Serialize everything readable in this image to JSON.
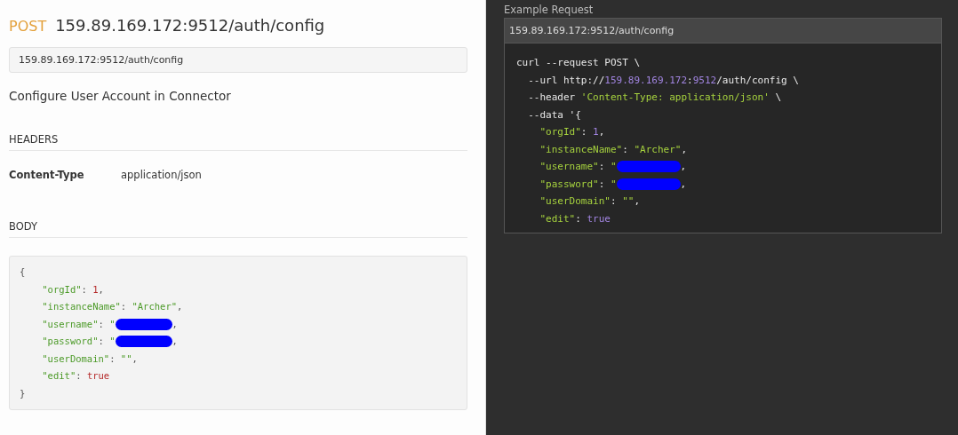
{
  "endpoint": {
    "method": "POST",
    "path": "159.89.169.172:9512/auth/config",
    "url_field": "159.89.169.172:9512/auth/config",
    "description": "Configure User Account in Connector"
  },
  "headers": {
    "title": "HEADERS",
    "rows": [
      {
        "name": "Content-Type",
        "value": "application/json"
      }
    ]
  },
  "body": {
    "title": "BODY",
    "lines": [
      [
        {
          "kind": "punct",
          "text": "{"
        }
      ],
      [
        {
          "kind": "key",
          "text": "    \"orgId\""
        },
        {
          "kind": "punct",
          "text": ": "
        },
        {
          "kind": "number",
          "text": "1"
        },
        {
          "kind": "punct",
          "text": ","
        }
      ],
      [
        {
          "kind": "key",
          "text": "    \"instanceName\""
        },
        {
          "kind": "punct",
          "text": ": "
        },
        {
          "kind": "string",
          "text": "\"Archer\""
        },
        {
          "kind": "punct",
          "text": ","
        }
      ],
      [
        {
          "kind": "key",
          "text": "    \"username\""
        },
        {
          "kind": "punct",
          "text": ": "
        },
        {
          "kind": "string",
          "text": "\""
        },
        {
          "kind": "redaction"
        },
        {
          "kind": "punct",
          "text": ","
        }
      ],
      [
        {
          "kind": "key",
          "text": "    \"password\""
        },
        {
          "kind": "punct",
          "text": ": "
        },
        {
          "kind": "string",
          "text": "\""
        },
        {
          "kind": "redaction"
        },
        {
          "kind": "punct",
          "text": ","
        }
      ],
      [
        {
          "kind": "key",
          "text": "    \"userDomain\""
        },
        {
          "kind": "punct",
          "text": ": "
        },
        {
          "kind": "string",
          "text": "\"\""
        },
        {
          "kind": "punct",
          "text": ","
        }
      ],
      [
        {
          "kind": "key",
          "text": "    \"edit\""
        },
        {
          "kind": "punct",
          "text": ": "
        },
        {
          "kind": "number",
          "text": "true"
        }
      ],
      [
        {
          "kind": "punct",
          "text": "}"
        }
      ]
    ]
  },
  "example": {
    "title": "Example Request",
    "url": "159.89.169.172:9512/auth/config",
    "lines": [
      [
        {
          "kind": "plain",
          "text": "curl --request POST \\"
        }
      ],
      [
        {
          "kind": "plain",
          "text": "  --url http://"
        },
        {
          "kind": "number",
          "text": "159.89.169.172"
        },
        {
          "kind": "plain",
          "text": ":"
        },
        {
          "kind": "number",
          "text": "9512"
        },
        {
          "kind": "plain",
          "text": "/auth/config \\"
        }
      ],
      [
        {
          "kind": "plain",
          "text": "  --header "
        },
        {
          "kind": "string",
          "text": "'Content-Type: application/json'"
        },
        {
          "kind": "plain",
          "text": " \\"
        }
      ],
      [
        {
          "kind": "plain",
          "text": "  --data '{"
        }
      ],
      [
        {
          "kind": "string",
          "text": "    \"orgId\""
        },
        {
          "kind": "plain",
          "text": ": "
        },
        {
          "kind": "number",
          "text": "1"
        },
        {
          "kind": "plain",
          "text": ","
        }
      ],
      [
        {
          "kind": "string",
          "text": "    \"instanceName\""
        },
        {
          "kind": "plain",
          "text": ": "
        },
        {
          "kind": "string",
          "text": "\"Archer\""
        },
        {
          "kind": "plain",
          "text": ","
        }
      ],
      [
        {
          "kind": "string",
          "text": "    \"username\""
        },
        {
          "kind": "plain",
          "text": ": "
        },
        {
          "kind": "string",
          "text": "\""
        },
        {
          "kind": "redaction"
        },
        {
          "kind": "plain",
          "text": ","
        }
      ],
      [
        {
          "kind": "string",
          "text": "    \"password\""
        },
        {
          "kind": "plain",
          "text": ": "
        },
        {
          "kind": "string",
          "text": "\""
        },
        {
          "kind": "redaction"
        },
        {
          "kind": "plain",
          "text": ","
        }
      ],
      [
        {
          "kind": "string",
          "text": "    \"userDomain\""
        },
        {
          "kind": "plain",
          "text": ": "
        },
        {
          "kind": "string",
          "text": "\"\""
        },
        {
          "kind": "plain",
          "text": ","
        }
      ],
      [
        {
          "kind": "string",
          "text": "    \"edit\""
        },
        {
          "kind": "plain",
          "text": ": "
        },
        {
          "kind": "number",
          "text": "true"
        }
      ]
    ]
  }
}
